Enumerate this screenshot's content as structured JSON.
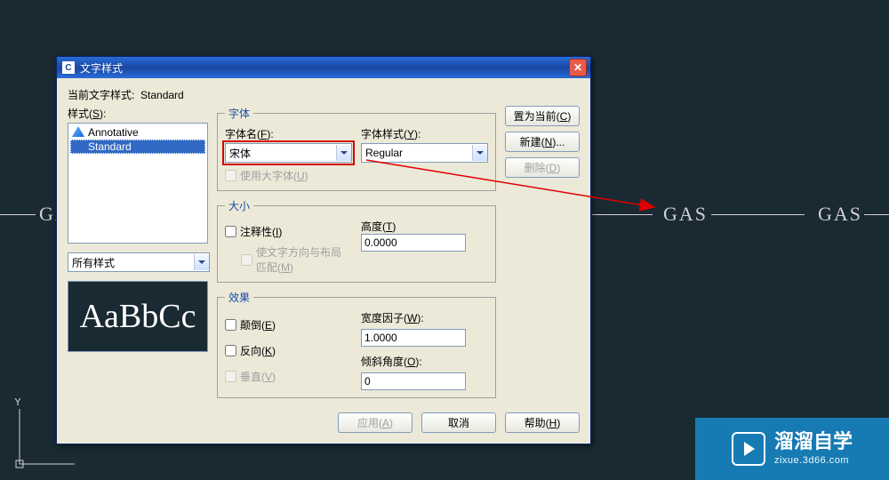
{
  "dialog": {
    "title": "文字样式",
    "current_label": "当前文字样式:",
    "current_value": "Standard",
    "styles_label": "样式(S):",
    "style_items": [
      "Annotative",
      "Standard"
    ],
    "filter": "所有样式",
    "preview": "AaBbCc",
    "font": {
      "legend": "字体",
      "name_label": "字体名(F):",
      "name_value": "宋体",
      "style_label": "字体样式(Y):",
      "style_value": "Regular",
      "bigfont": "使用大字体(U)"
    },
    "size": {
      "legend": "大小",
      "annotative": "注释性(I)",
      "match_orient": "使文字方向与布局匹配(M)",
      "height_label": "高度(T)",
      "height_value": "0.0000"
    },
    "effects": {
      "legend": "效果",
      "upside_down": "颠倒(E)",
      "backwards": "反向(K)",
      "vertical": "垂直(V)",
      "width_label": "宽度因子(W):",
      "width_value": "1.0000",
      "oblique_label": "倾斜角度(O):",
      "oblique_value": "0"
    },
    "buttons": {
      "set_current": "置为当前(C)",
      "new": "新建(N)...",
      "delete": "删除(D)",
      "apply": "应用(A)",
      "cancel": "取消",
      "help": "帮助(H)"
    }
  },
  "bg": {
    "gas1": "GA",
    "gas2": "GAS",
    "gas3": "GAS"
  },
  "ucs": {
    "y": "Y"
  },
  "watermark": {
    "line1": "溜溜自学",
    "line2": "zixue.3d66.com"
  }
}
